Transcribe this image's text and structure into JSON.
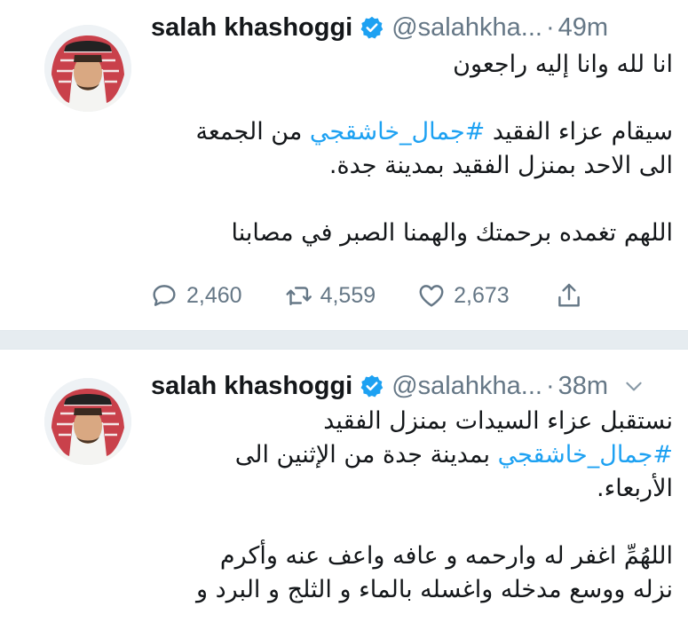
{
  "colors": {
    "link": "#1da1f2",
    "text": "#14171a",
    "muted": "#657786",
    "verified": "#1da1f2",
    "separator": "#e6ecf0"
  },
  "tweets": [
    {
      "author": {
        "name": "salah khashoggi",
        "handle": "@salahkha...",
        "verified": true,
        "avatar_icon": "profile-photo"
      },
      "time": "49m",
      "body": {
        "p1": {
          "l1": "انا لله وانا إليه راجعون"
        },
        "p2": {
          "l1_before": "سيقام عزاء الفقيد ",
          "l1_hashtag": "#جمال_خاشقجي",
          "l1_after": " من الجمعة",
          "l2": "الى الاحد بمنزل الفقيد بمدينة جدة."
        },
        "p3": {
          "l1": "اللهم تغمده برحمتك والهمنا الصبر في مصابنا"
        }
      },
      "actions": {
        "replies": "2,460",
        "retweets": "4,559",
        "likes": "2,673"
      }
    },
    {
      "author": {
        "name": "salah khashoggi",
        "handle": "@salahkha...",
        "verified": true,
        "avatar_icon": "profile-photo"
      },
      "time": "38m",
      "body": {
        "p1": {
          "l1": "نستقبل عزاء السيدات بمنزل الفقيد",
          "l2_hashtag": "#جمال_خاشقجي",
          "l2_after": " بمدينة جدة من الإثنين الى",
          "l3": "الأربعاء."
        },
        "p2": {
          "l1": "اللهُمِّ اغفر له وارحمه و عافه واعف عنه وأكرم",
          "l2": "نزله ووسع مدخله واغسله بالماء و الثلج و البرد و"
        }
      }
    }
  ]
}
